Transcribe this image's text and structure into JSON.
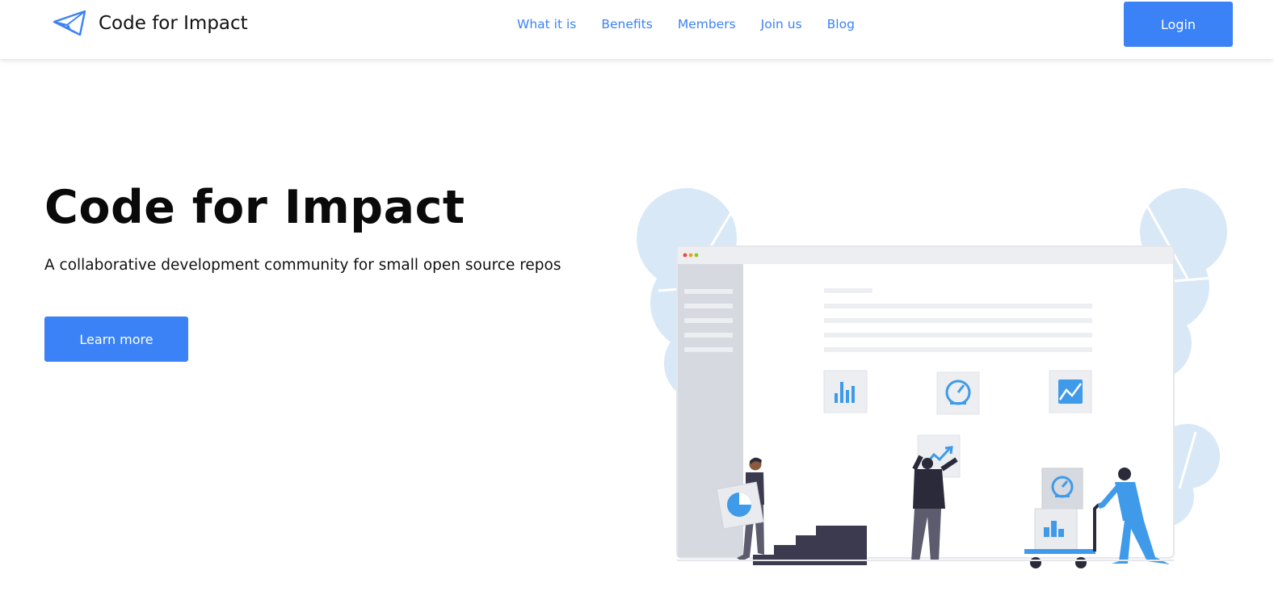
{
  "brand": {
    "name": "Code for Impact",
    "icon": "paper-plane-icon"
  },
  "nav": {
    "links": [
      "What it is",
      "Benefits",
      "Members",
      "Join us",
      "Blog"
    ],
    "login_label": "Login"
  },
  "hero": {
    "title": "Code for Impact",
    "subtitle": "A collaborative development community for small open source repos",
    "cta_label": "Learn more"
  },
  "colors": {
    "accent": "#3b82f6",
    "illustration_blue": "#3f9be9",
    "blob": "#d8e8f6"
  }
}
